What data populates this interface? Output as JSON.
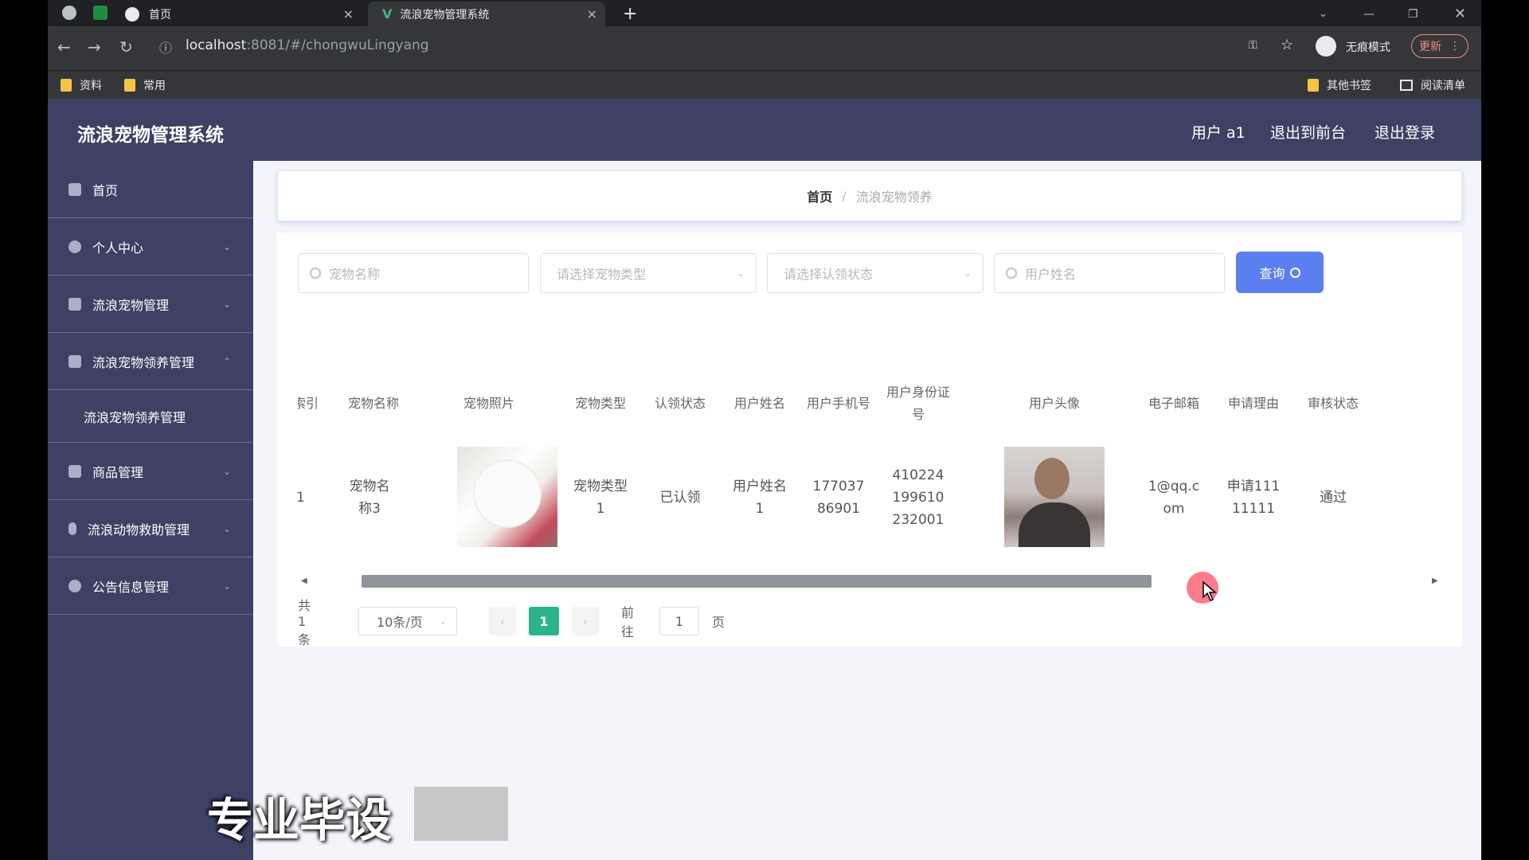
{
  "browser": {
    "tabs": [
      {
        "label": "首页"
      },
      {
        "label": "流浪宠物管理系统"
      }
    ],
    "close_glyph": "×",
    "new_tab_glyph": "+",
    "url_host": "localhost",
    "url_path": ":8081/#/chongwuLingyang",
    "incognito_label": "无痕模式",
    "update_label": "更新",
    "bookmarks": [
      "资料",
      "常用"
    ],
    "other_bookmarks": "其他书签",
    "reading_list": "阅读清单"
  },
  "app": {
    "title": "流浪宠物管理系统",
    "user_label": "用户 a1",
    "to_front_label": "退出到前台",
    "logout_label": "退出登录"
  },
  "sidebar": {
    "items": [
      {
        "label": "首页",
        "icon": "home-icon"
      },
      {
        "label": "个人中心",
        "icon": "user-icon"
      },
      {
        "label": "流浪宠物管理",
        "icon": "pet-icon"
      },
      {
        "label": "流浪宠物领养管理",
        "icon": "adopt-icon"
      },
      {
        "label": "流浪宠物领养管理",
        "icon": "sub"
      },
      {
        "label": "商品管理",
        "icon": "goods-icon"
      },
      {
        "label": "流浪动物救助管理",
        "icon": "rescue-icon"
      },
      {
        "label": "公告信息管理",
        "icon": "notice-icon"
      }
    ]
  },
  "breadcrumb": {
    "home": "首页",
    "separator": "/",
    "current": "流浪宠物领养"
  },
  "filters": {
    "pet_name_placeholder": "宠物名称",
    "pet_type_placeholder": "请选择宠物类型",
    "adopt_status_placeholder": "请选择认领状态",
    "user_name_placeholder": "用户姓名",
    "query_label": "查询"
  },
  "table": {
    "headers": [
      "索引",
      "宠物名称",
      "宠物照片",
      "宠物类型",
      "认领状态",
      "用户姓名",
      "用户手机号",
      "用户身份证号",
      "用户头像",
      "电子邮箱",
      "申请理由",
      "审核状态"
    ],
    "rows": [
      {
        "index": "1",
        "pet_name": "宠物名称3",
        "pet_type": "宠物类型1",
        "adopt_status": "已认领",
        "user_name": "用户姓名1",
        "phone": "17703786901",
        "id_card": "410224199610232001",
        "email": "1@qq.com",
        "reason": "申请11111111",
        "review_status": "通过"
      }
    ]
  },
  "pagination": {
    "total": "共 1 条",
    "page_size": "10条/页",
    "current_page": "1",
    "goto_prefix": "前往",
    "goto_value": "1",
    "goto_suffix": "页"
  },
  "overlay": {
    "watermark": "专业毕设"
  },
  "colors": {
    "sidebar_bg": "#3d4163",
    "accent": "#5b7ef0",
    "page_active": "#2bb48a"
  }
}
